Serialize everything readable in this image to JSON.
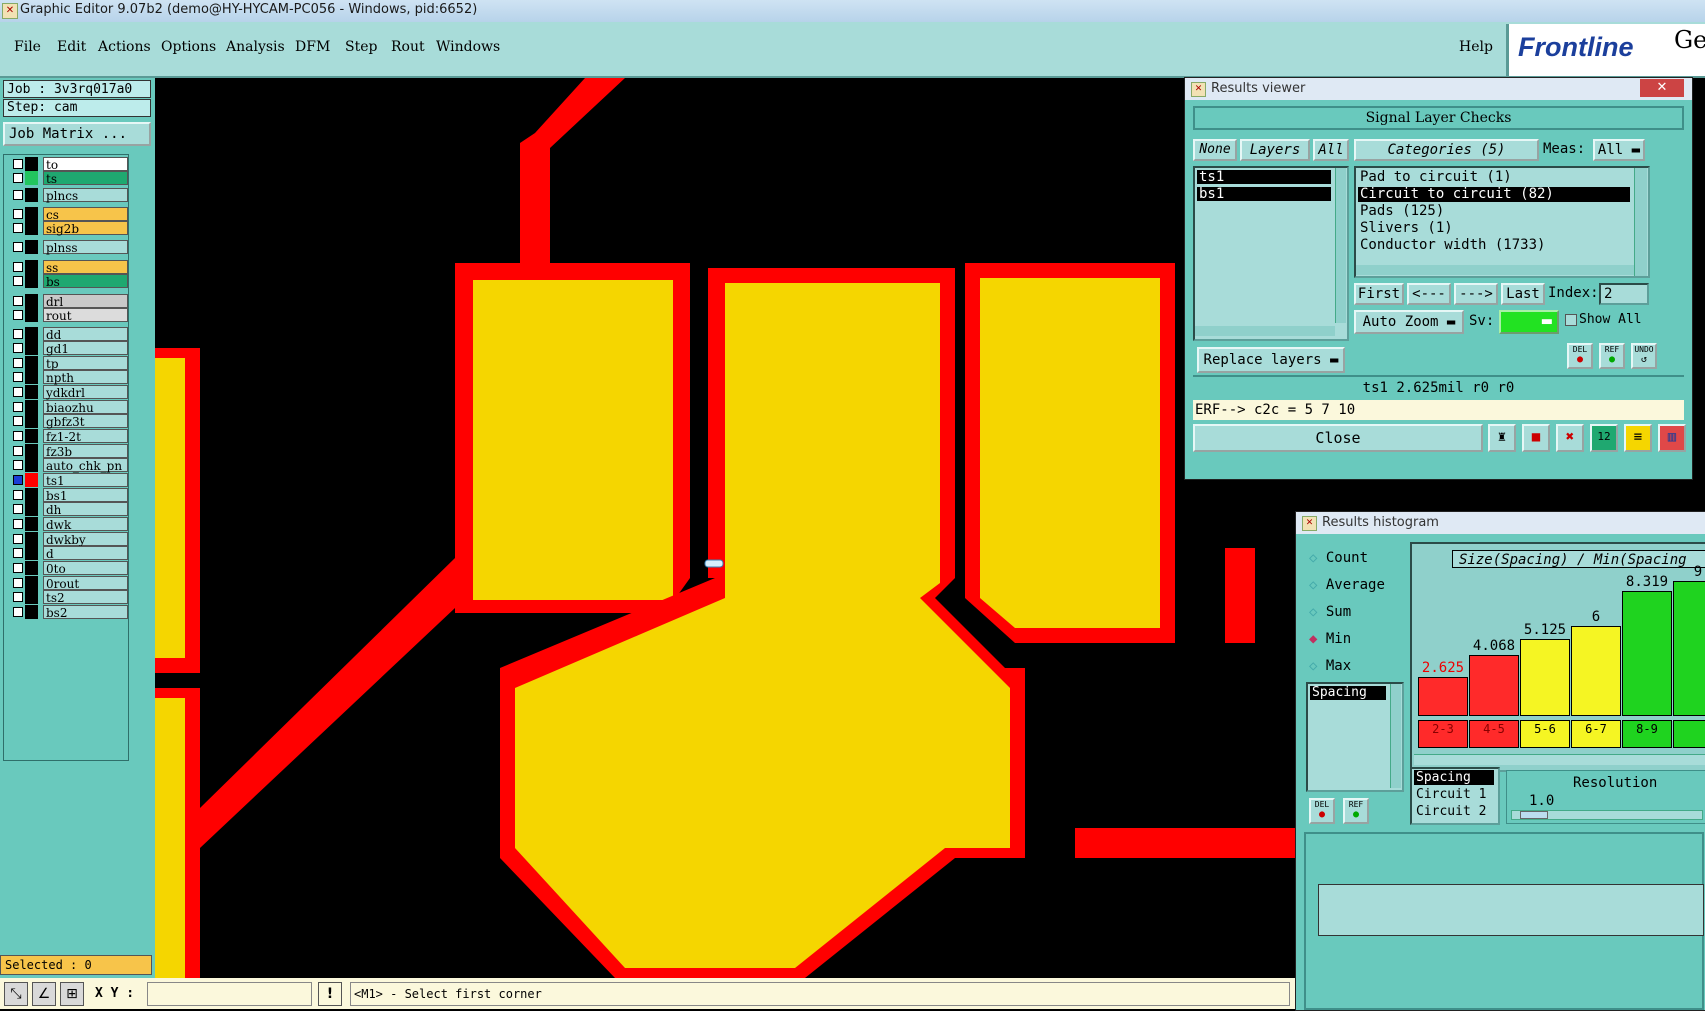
{
  "window": {
    "title": "Graphic Editor 9.07b2 (demo@HY-HYCAM-PC056 - Windows, pid:6652)"
  },
  "menu": {
    "items": [
      "File",
      "Edit",
      "Actions",
      "Options",
      "Analysis",
      "DFM",
      "Step",
      "Rout",
      "Windows"
    ],
    "help": "Help"
  },
  "logo": {
    "brand": "Frontline",
    "suffix": "Ge"
  },
  "left": {
    "job": "Job : 3v3rq017a0",
    "step": "Step: cam",
    "job_matrix": "Job Matrix ...",
    "layers": [
      {
        "name": "to",
        "swatch": "#000000",
        "bg": "#ffffff"
      },
      {
        "name": "ts",
        "swatch": "#22c55e",
        "bg": "#1fa870"
      },
      {
        "name": "plncs",
        "swatch": "#000000",
        "bg": "#a8dcd9"
      },
      {
        "name": "cs",
        "swatch": "#000000",
        "bg": "#f7c44a"
      },
      {
        "name": "sig2b",
        "swatch": "#000000",
        "bg": "#f7c44a"
      },
      {
        "name": "plnss",
        "swatch": "#000000",
        "bg": "#a8dcd9"
      },
      {
        "name": "ss",
        "swatch": "#000000",
        "bg": "#f7c44a"
      },
      {
        "name": "bs",
        "swatch": "#000000",
        "bg": "#1fa870"
      },
      {
        "name": "drl",
        "swatch": "#000000",
        "bg": "#c9c9c9"
      },
      {
        "name": "rout",
        "swatch": "#000000",
        "bg": "#dcdcdc"
      },
      {
        "name": "dd",
        "swatch": "#000000",
        "bg": "#a8dcd9"
      },
      {
        "name": "gd1",
        "swatch": "#000000",
        "bg": "#a8dcd9"
      },
      {
        "name": "tp",
        "swatch": "#000000",
        "bg": "#a8dcd9"
      },
      {
        "name": "npth",
        "swatch": "#000000",
        "bg": "#a8dcd9"
      },
      {
        "name": "ydkdrl",
        "swatch": "#000000",
        "bg": "#a8dcd9"
      },
      {
        "name": "biaozhu",
        "swatch": "#000000",
        "bg": "#a8dcd9"
      },
      {
        "name": "gbfz3t",
        "swatch": "#000000",
        "bg": "#a8dcd9"
      },
      {
        "name": "fz1-2t",
        "swatch": "#000000",
        "bg": "#a8dcd9"
      },
      {
        "name": "fz3b",
        "swatch": "#000000",
        "bg": "#a8dcd9"
      },
      {
        "name": "auto_chk_pn",
        "swatch": "#000000",
        "bg": "#a8dcd9"
      },
      {
        "name": "ts1",
        "swatch": "#ff0000",
        "bg": "#a8dcd9"
      },
      {
        "name": "bs1",
        "swatch": "#000000",
        "bg": "#a8dcd9"
      },
      {
        "name": "dh",
        "swatch": "#000000",
        "bg": "#a8dcd9"
      },
      {
        "name": "dwk",
        "swatch": "#000000",
        "bg": "#a8dcd9"
      },
      {
        "name": "dwkby",
        "swatch": "#000000",
        "bg": "#a8dcd9"
      },
      {
        "name": "d",
        "swatch": "#000000",
        "bg": "#a8dcd9"
      },
      {
        "name": "0to",
        "swatch": "#000000",
        "bg": "#a8dcd9"
      },
      {
        "name": "0rout",
        "swatch": "#000000",
        "bg": "#a8dcd9"
      },
      {
        "name": "ts2",
        "swatch": "#000000",
        "bg": "#a8dcd9"
      },
      {
        "name": "bs2",
        "swatch": "#000000",
        "bg": "#a8dcd9"
      }
    ],
    "selected": "Selected : 0"
  },
  "bottom": {
    "xy_label": "X Y :",
    "xy_value": "",
    "excl": "!",
    "status": "<M1> - Select first corner"
  },
  "results_viewer": {
    "title": "Results viewer",
    "close_x": "✕",
    "header": "Signal Layer Checks",
    "none": "None",
    "layers_label": "Layers",
    "all": "All",
    "categories_label": "Categories (5)",
    "meas_label": "Meas:",
    "meas_value": "All",
    "layers": [
      "ts1",
      "bs1"
    ],
    "categories": [
      "Pad to circuit (1)",
      "Circuit to circuit (82)",
      "Pads (125)",
      "Slivers (1)",
      "Conductor width (1733)"
    ],
    "first": "First",
    "prev": "<---",
    "next": "--->",
    "last": "Last",
    "index_label": "Index:",
    "index_value": "2",
    "auto_zoom": "Auto Zoom",
    "sv_label": "Sv:",
    "show_all": "Show All",
    "del": "DEL",
    "ref": "REF",
    "undo": "UNDO",
    "replace_layers": "Replace layers",
    "info": "ts1 2.625mil  r0  r0",
    "erf": "ERF--> c2c = 5 7 10",
    "close": "Close",
    "tool_icons": [
      "person-icon",
      "film-icon",
      "erf-icon",
      "counter-icon",
      "report-icon",
      "histogram-icon"
    ]
  },
  "histogram": {
    "title": "Results histogram",
    "options": [
      "Count",
      "Average",
      "Sum",
      "Min",
      "Max"
    ],
    "selected_option": "Min",
    "list_item": "Spacing",
    "chart_title": "Size(Spacing) / Min(Spacing",
    "bins": [
      {
        "label": "2-3",
        "value": "2.625",
        "color": "#ff2a2a"
      },
      {
        "label": "4-5",
        "value": "4.068",
        "color": "#ff2a2a"
      },
      {
        "label": "5-6",
        "value": "5.125",
        "color": "#f5f523"
      },
      {
        "label": "6-7",
        "value": "6",
        "color": "#f5f523"
      },
      {
        "label": "8-9",
        "value": "8.319",
        "color": "#1fd31f"
      },
      {
        "label": "",
        "value": "9",
        "color": "#1fd31f"
      }
    ],
    "legend_items": [
      "Spacing",
      "Circuit 1",
      "Circuit 2"
    ],
    "resolution_label": "Resolution",
    "resolution_value": "1.0",
    "del": "DEL",
    "ref": "REF"
  }
}
